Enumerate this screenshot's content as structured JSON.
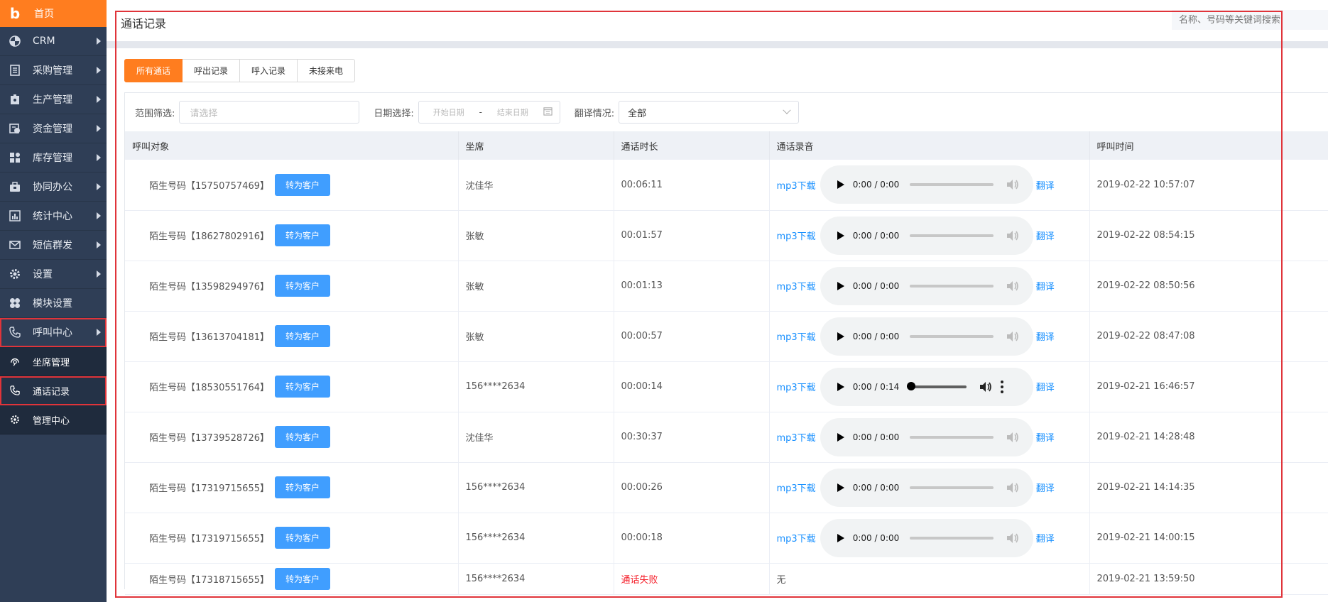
{
  "sidebar": {
    "home": "首页",
    "items": [
      {
        "label": "CRM",
        "icon": "pie-icon"
      },
      {
        "label": "采购管理",
        "icon": "doc-icon"
      },
      {
        "label": "生产管理",
        "icon": "factory-icon"
      },
      {
        "label": "资金管理",
        "icon": "money-icon"
      },
      {
        "label": "库存管理",
        "icon": "grid-icon"
      },
      {
        "label": "协同办公",
        "icon": "briefcase-icon"
      },
      {
        "label": "统计中心",
        "icon": "chart-icon"
      },
      {
        "label": "短信群发",
        "icon": "mail-icon"
      },
      {
        "label": "设置",
        "icon": "gear-icon"
      },
      {
        "label": "模块设置",
        "icon": "module-icon"
      },
      {
        "label": "呼叫中心",
        "icon": "phone-icon"
      }
    ],
    "sub_items": [
      {
        "label": "坐席管理",
        "icon": "headset-icon"
      },
      {
        "label": "通话记录",
        "icon": "call-log-icon"
      },
      {
        "label": "管理中心",
        "icon": "cog-icon"
      }
    ]
  },
  "header": {
    "title": "通话记录",
    "search_placeholder": "名称、号码等关键词搜索"
  },
  "tabs": [
    "所有通话",
    "呼出记录",
    "呼入记录",
    "未接来电"
  ],
  "filters": {
    "range_label": "范围筛选:",
    "range_placeholder": "请选择",
    "date_label": "日期选择:",
    "date_start": "开始日期",
    "date_sep": "-",
    "date_end": "结束日期",
    "translate_label": "翻译情况:",
    "translate_value": "全部"
  },
  "table": {
    "columns": [
      "呼叫对象",
      "坐席",
      "通话时长",
      "通话录音",
      "呼叫时间"
    ],
    "convert_label": "转为客户",
    "mp3_label": "mp3下载",
    "translate_label": "翻译",
    "rows": [
      {
        "target": "陌生号码【15750757469】",
        "agent": "沈佳华",
        "duration": "00:06:11",
        "player_time": "0:00 / 0:00",
        "time": "2019-02-22 10:57:07"
      },
      {
        "target": "陌生号码【18627802916】",
        "agent": "张敏",
        "duration": "00:01:57",
        "player_time": "0:00 / 0:00",
        "time": "2019-02-22 08:54:15"
      },
      {
        "target": "陌生号码【13598294976】",
        "agent": "张敏",
        "duration": "00:01:13",
        "player_time": "0:00 / 0:00",
        "time": "2019-02-22 08:50:56"
      },
      {
        "target": "陌生号码【13613704181】",
        "agent": "张敏",
        "duration": "00:00:57",
        "player_time": "0:00 / 0:00",
        "time": "2019-02-22 08:47:08"
      },
      {
        "target": "陌生号码【18530551764】",
        "agent": "156****2634",
        "duration": "00:00:14",
        "player_time": "0:00 / 0:14",
        "time": "2019-02-21 16:46:57"
      },
      {
        "target": "陌生号码【13739528726】",
        "agent": "沈佳华",
        "duration": "00:30:37",
        "player_time": "0:00 / 0:00",
        "time": "2019-02-21 14:28:48"
      },
      {
        "target": "陌生号码【17319715655】",
        "agent": "156****2634",
        "duration": "00:00:26",
        "player_time": "0:00 / 0:00",
        "time": "2019-02-21 14:14:35"
      },
      {
        "target": "陌生号码【17319715655】",
        "agent": "156****2634",
        "duration": "00:00:18",
        "player_time": "0:00 / 0:00",
        "time": "2019-02-21 14:00:15"
      }
    ],
    "last_row": {
      "target": "陌生号码【17318715655】",
      "agent": "156****2634",
      "status": "通话失败",
      "recording": "无",
      "time": "2019-02-21 13:59:50"
    }
  },
  "colors": {
    "accent": "#ff7d1f",
    "sidebar": "#2f3e56",
    "primary": "#409eff",
    "link": "#1890ff",
    "highlight": "#e0343a",
    "fail": "#f5222d"
  }
}
